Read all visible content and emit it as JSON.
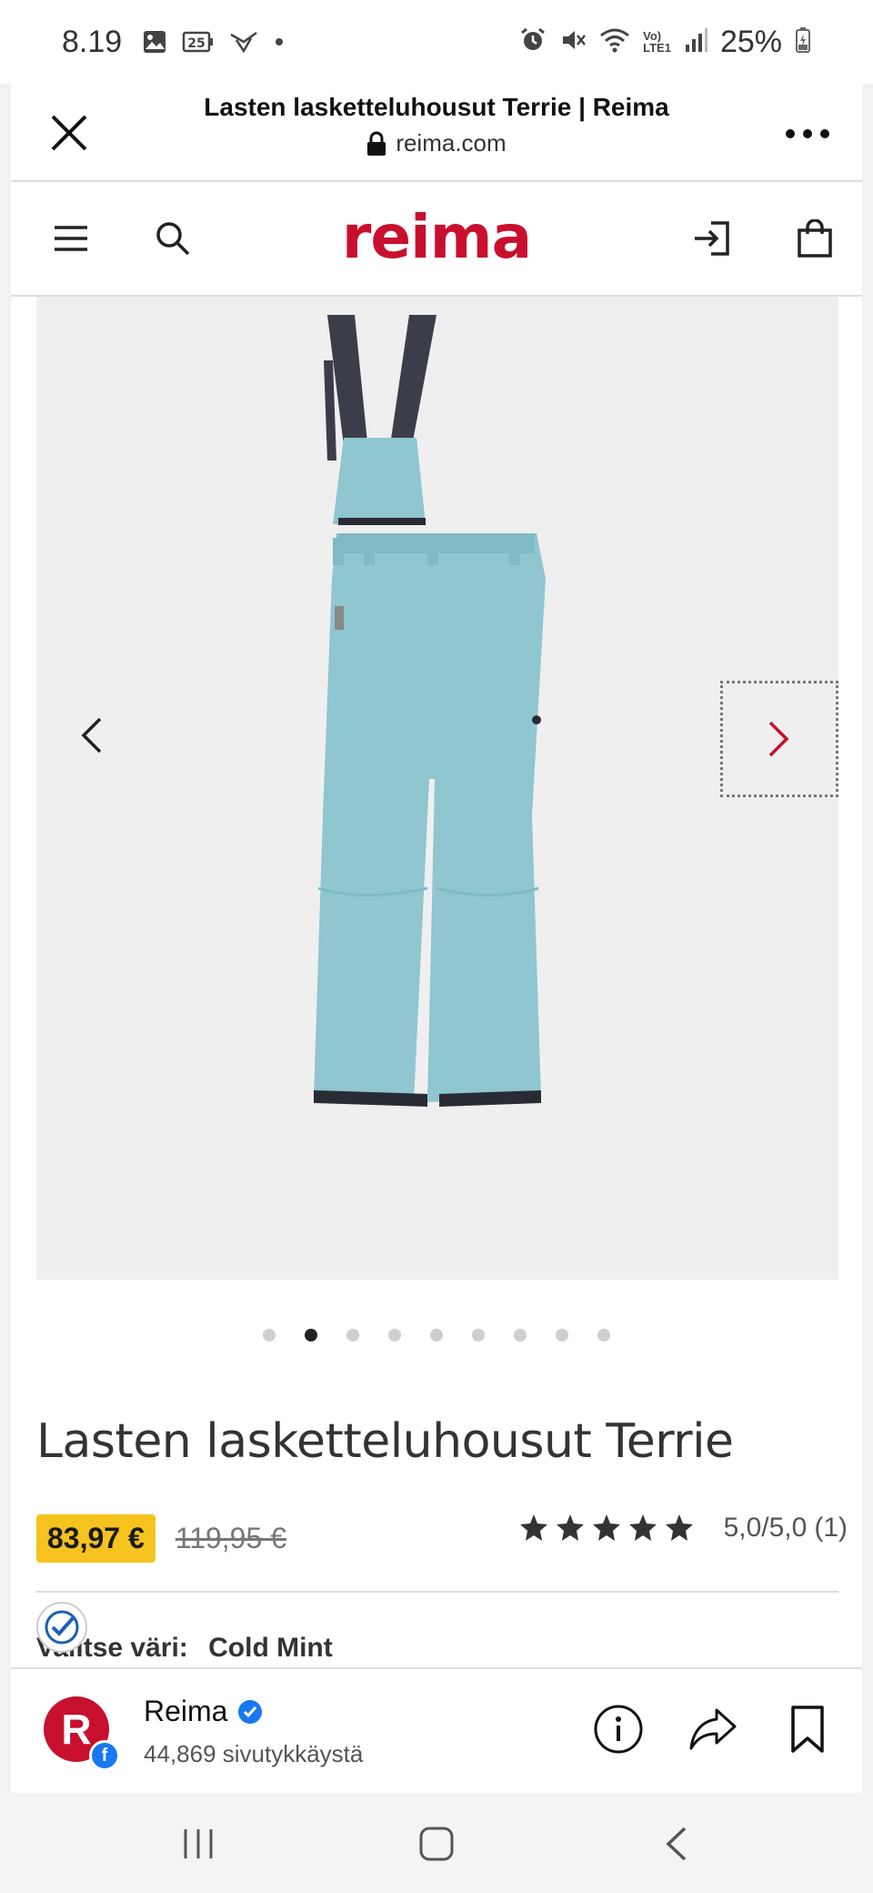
{
  "status_bar": {
    "time": "8.19",
    "notification_count": "25",
    "battery": "25%",
    "network_label_top": "Vo)",
    "network_label_bottom": "LTE1"
  },
  "browser": {
    "page_title": "Lasten lasketteluhousut Terrie | Reima",
    "url": "reima.com"
  },
  "site": {
    "logo": "reima",
    "brand_color": "#c8102e"
  },
  "gallery": {
    "dot_count": 9,
    "active_dot": 1
  },
  "product": {
    "title": "Lasten lasketteluhousut Terrie",
    "sale_price": "83,97 €",
    "original_price": "119,95 €",
    "rating_stars": 5,
    "rating_text": "5,0/5,0",
    "review_count": "(1)",
    "color_label": "Valitse väri:",
    "color_value": "Cold Mint",
    "pants_color": "#8fc6d0"
  },
  "fb_page": {
    "avatar_letter": "R",
    "name": "Reima",
    "subtitle": "44,869 sivutykkäystä"
  }
}
